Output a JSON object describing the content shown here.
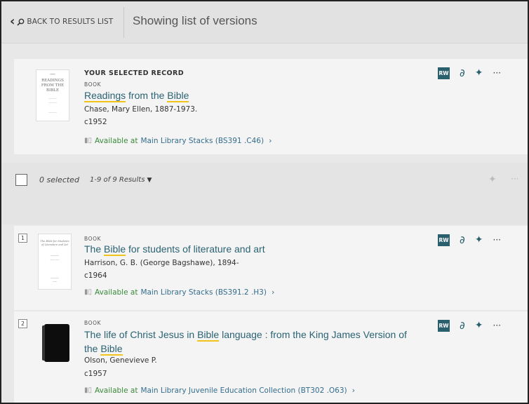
{
  "header": {
    "back_label": "BACK TO RESULTS LIST",
    "title": "Showing list of versions"
  },
  "selected_record": {
    "heading": "YOUR SELECTED RECORD",
    "type": "BOOK",
    "title_pre": "",
    "title_hl": "Readings",
    "title_mid": " from the ",
    "title_hl2": "Bible",
    "title_post": "",
    "author": "Chase, Mary Ellen, 1887-1973.",
    "date": "c1952",
    "avail_prefix": "Available at",
    "location": "Main Library  Stacks (BS391 .C46)",
    "thumb_lines": [
      "READINGS",
      "FROM THE",
      "BIBLE"
    ]
  },
  "actions": {
    "rw": "RW",
    "dots": "···"
  },
  "selection_bar": {
    "selected": "0 selected",
    "count": "1-9 of 9 Results"
  },
  "results": [
    {
      "num": "1",
      "type": "BOOK",
      "title_pre": "The ",
      "title_hl": "Bible",
      "title_post": " for students of literature and art",
      "author": "Harrison, G. B. (George Bagshawe), 1894-",
      "date": "c1964",
      "avail_prefix": "Available at",
      "location": "Main Library  Stacks (BS391.2 .H3)",
      "thumb_lines": [
        "The Bible for Students",
        "of Literature and Art"
      ]
    },
    {
      "num": "2",
      "type": "BOOK",
      "title_line1_pre": "The life of Christ Jesus in ",
      "title_line1_hl": "Bible",
      "title_line1_post": " language : from the King James Version of",
      "title_line2_pre": "the ",
      "title_line2_hl": "Bible",
      "author": "Olson, Genevieve P.",
      "date": "c1957",
      "avail_prefix": "Available at",
      "location": "Main Library  Juvenile Education Collection (BT302 .O63)"
    }
  ]
}
